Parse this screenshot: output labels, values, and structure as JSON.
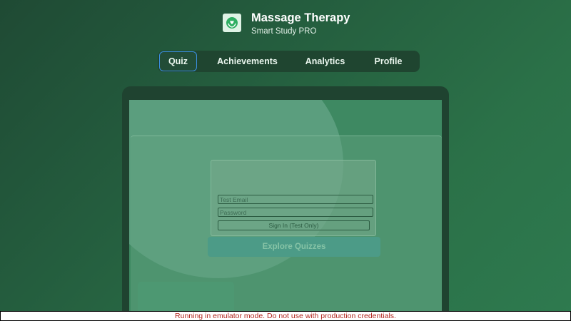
{
  "header": {
    "title": "Massage Therapy",
    "subtitle": "Smart Study PRO",
    "icon": "hands-heart-icon"
  },
  "nav": {
    "tabs": [
      {
        "label": "Quiz",
        "active": true
      },
      {
        "label": "Achievements",
        "active": false
      },
      {
        "label": "Analytics",
        "active": false
      },
      {
        "label": "Profile",
        "active": false
      }
    ]
  },
  "device_preview": {
    "login": {
      "email_placeholder": "Test Email",
      "password_placeholder": "Password",
      "signin_label": "Sign In (Test Only)"
    },
    "explore_label": "Explore Quizzes"
  },
  "banner": {
    "text": "Running in emulator mode. Do not use with production credentials."
  },
  "colors": {
    "accent": "#3b8fe0",
    "brand_green": "#2e7a4f",
    "warning_text": "#b3261e"
  }
}
